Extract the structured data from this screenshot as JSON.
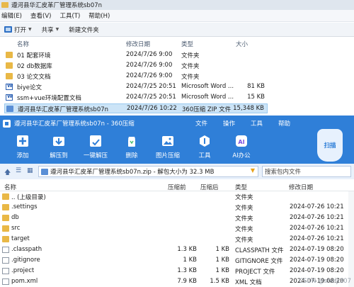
{
  "explorer": {
    "title": "遵河县华汇皮革厂管理系统sb07n",
    "menu": [
      "编辑(E)",
      "查看(V)",
      "工具(T)",
      "帮助(H)"
    ],
    "toolbar": {
      "open": "打开",
      "share": "共享",
      "new_folder": "新建文件夹"
    },
    "columns": {
      "name": "名称",
      "date": "修改日期",
      "type": "类型",
      "size": "大小"
    },
    "rows": [
      {
        "name": "01 配套环境",
        "date": "2024/7/26 9:00",
        "type": "文件夹",
        "size": "",
        "icon": "folder-icon"
      },
      {
        "name": "02 db数据库",
        "date": "2024/7/26 9:00",
        "type": "文件夹",
        "size": "",
        "icon": "folder-icon"
      },
      {
        "name": "03 论文文档",
        "date": "2024/7/26 9:00",
        "type": "文件夹",
        "size": "",
        "icon": "folder-icon"
      },
      {
        "name": "biye论文",
        "date": "2024/7/25 20:51",
        "type": "Microsoft Word ...",
        "size": "81 KB",
        "icon": "word-doc-icon"
      },
      {
        "name": "ssm+vue环境配置文档",
        "date": "2024/7/25 20:51",
        "type": "Microsoft Word ...",
        "size": "15 KB",
        "icon": "word-doc-icon"
      },
      {
        "name": "遵河县华汇皮革厂管理系统sb07n",
        "date": "2024/7/26 10:22",
        "type": "360压缩 ZIP 文件",
        "size": "15,348 KB",
        "icon": "zip-archive-icon"
      }
    ]
  },
  "zip": {
    "title": "遵河县华汇皮革厂管理系统sb07n - 360压缩",
    "menu": [
      "文件",
      "操作",
      "工具",
      "帮助"
    ],
    "tools": [
      {
        "label": "添加",
        "color": "#ffffff"
      },
      {
        "label": "解压到",
        "color": "#ffffff"
      },
      {
        "label": "一键解压",
        "color": "#ffffff"
      },
      {
        "label": "删除",
        "color": "#ffffff"
      },
      {
        "label": "图片压缩",
        "color": "#ffffff"
      },
      {
        "label": "工具",
        "color": "#ffffff"
      },
      {
        "label": "AI办公",
        "color": "#ffffff"
      }
    ],
    "scan_label": "扫描",
    "address": "遵河县华汇皮革厂管理系统sb07n.zip - 解包大小为 32.3 MB",
    "search_placeholder": "搜索包内文件",
    "columns": {
      "name": "名称",
      "compressed": "压缩前",
      "after": "压缩后",
      "type": "类型",
      "date": "修改日期"
    },
    "rows": [
      {
        "name": ".. (上级目录)",
        "compressed": "",
        "after": "",
        "type": "文件夹",
        "date": "",
        "icon": "folder-icon"
      },
      {
        "name": ".settings",
        "compressed": "",
        "after": "",
        "type": "文件夹",
        "date": "2024-07-26 10:21",
        "icon": "folder-icon"
      },
      {
        "name": "db",
        "compressed": "",
        "after": "",
        "type": "文件夹",
        "date": "2024-07-26 10:21",
        "icon": "folder-icon"
      },
      {
        "name": "src",
        "compressed": "",
        "after": "",
        "type": "文件夹",
        "date": "2024-07-26 10:21",
        "icon": "folder-icon"
      },
      {
        "name": "target",
        "compressed": "",
        "after": "",
        "type": "文件夹",
        "date": "2024-07-26 10:21",
        "icon": "folder-icon"
      },
      {
        "name": ".classpath",
        "compressed": "1.3 KB",
        "after": "1 KB",
        "type": "CLASSPATH 文件",
        "date": "2024-07-19 08:20",
        "icon": "file-icon"
      },
      {
        "name": ".gitignore",
        "compressed": "1 KB",
        "after": "1 KB",
        "type": "GITIGNORE 文件",
        "date": "2024-07-19 08:20",
        "icon": "file-icon"
      },
      {
        "name": ".project",
        "compressed": "1.3 KB",
        "after": "1 KB",
        "type": "PROJECT 文件",
        "date": "2024-07-19 08:20",
        "icon": "file-icon"
      },
      {
        "name": "pom.xml",
        "compressed": "7.9 KB",
        "after": "1.5 KB",
        "type": "XML 文档",
        "date": "2024-07-19 08:20",
        "icon": "file-icon"
      }
    ]
  },
  "watermark": "CSDN @shelji307"
}
